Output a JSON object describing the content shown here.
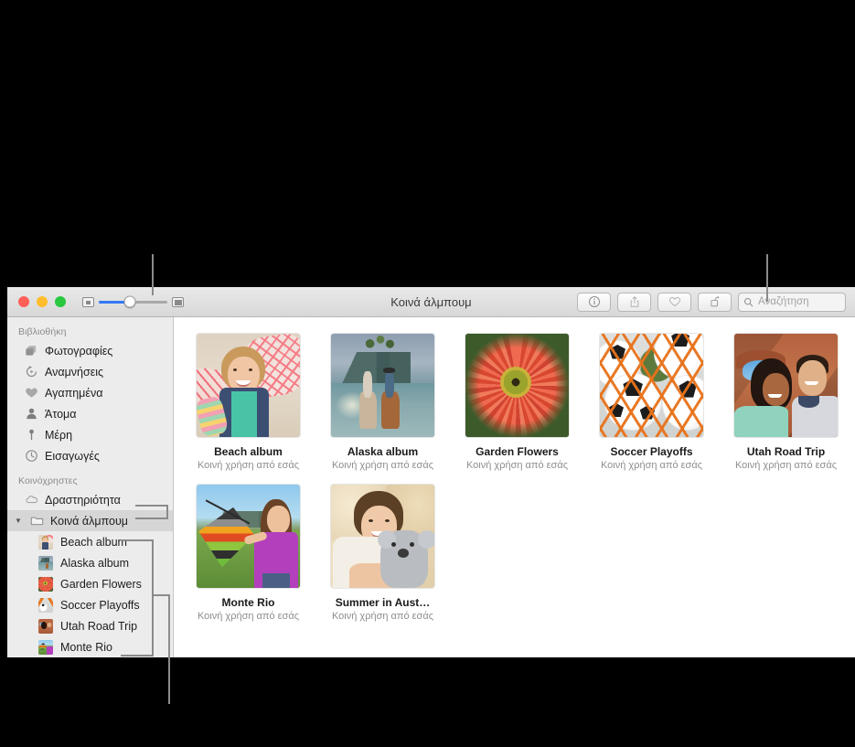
{
  "window": {
    "title": "Κοινά άλμπουμ",
    "traffic_lights": [
      "close-button",
      "minimize-button",
      "zoom-button"
    ],
    "zoom_slider": {
      "small_icon": "small-thumbnail-icon",
      "large_icon": "large-thumbnail-icon",
      "value": 45
    }
  },
  "toolbar": {
    "buttons": [
      {
        "name": "info-button",
        "icon": "info-icon"
      },
      {
        "name": "share-button",
        "icon": "share-icon"
      },
      {
        "name": "favorite-button",
        "icon": "heart-icon"
      },
      {
        "name": "rotate-button",
        "icon": "rotate-icon"
      }
    ],
    "search": {
      "icon": "search-icon",
      "placeholder": "Αναζήτηση"
    }
  },
  "sidebar": {
    "sections": [
      {
        "header": "Βιβλιοθήκη",
        "items": [
          {
            "label": "Φωτογραφίες",
            "icon": "photos-icon"
          },
          {
            "label": "Αναμνήσεις",
            "icon": "memories-icon"
          },
          {
            "label": "Αγαπημένα",
            "icon": "heart-icon"
          },
          {
            "label": "Άτομα",
            "icon": "person-icon"
          },
          {
            "label": "Μέρη",
            "icon": "pin-icon"
          },
          {
            "label": "Εισαγωγές",
            "icon": "clock-icon"
          }
        ]
      },
      {
        "header": "Κοινόχρηστες",
        "items": [
          {
            "label": "Δραστηριότητα",
            "icon": "cloud-icon"
          },
          {
            "label": "Κοινά άλμπουμ",
            "icon": "folder-icon",
            "selected": true,
            "expanded": true
          }
        ]
      }
    ],
    "shared_albums": [
      {
        "label": "Beach album",
        "thumb": "beach"
      },
      {
        "label": "Alaska album",
        "thumb": "alaska"
      },
      {
        "label": "Garden Flowers",
        "thumb": "flower"
      },
      {
        "label": "Soccer Playoffs",
        "thumb": "soccer"
      },
      {
        "label": "Utah Road Trip",
        "thumb": "utah"
      },
      {
        "label": "Monte Rio",
        "thumb": "kite"
      }
    ]
  },
  "content": {
    "albums": [
      {
        "name": "Beach album",
        "subtitle": "Κοινή χρήση από εσάς",
        "thumb": "beach"
      },
      {
        "name": "Alaska album",
        "subtitle": "Κοινή χρήση από εσάς",
        "thumb": "alaska"
      },
      {
        "name": "Garden Flowers",
        "subtitle": "Κοινή χρήση από εσάς",
        "thumb": "flower"
      },
      {
        "name": "Soccer Playoffs",
        "subtitle": "Κοινή χρήση από εσάς",
        "thumb": "soccer"
      },
      {
        "name": "Utah Road Trip",
        "subtitle": "Κοινή χρήση από εσάς",
        "thumb": "utah"
      },
      {
        "name": "Monte Rio",
        "subtitle": "Κοινή χρήση από εσάς",
        "thumb": "kite"
      },
      {
        "name": "Summer in Aust…",
        "subtitle": "Κοινή χρήση από εσάς",
        "thumb": "summer"
      }
    ]
  },
  "colors": {
    "accent": "#3478f6",
    "callout": "#8b8b8b",
    "sidebar_bg": "#ececec",
    "selected_row": "#d6d6d6"
  }
}
